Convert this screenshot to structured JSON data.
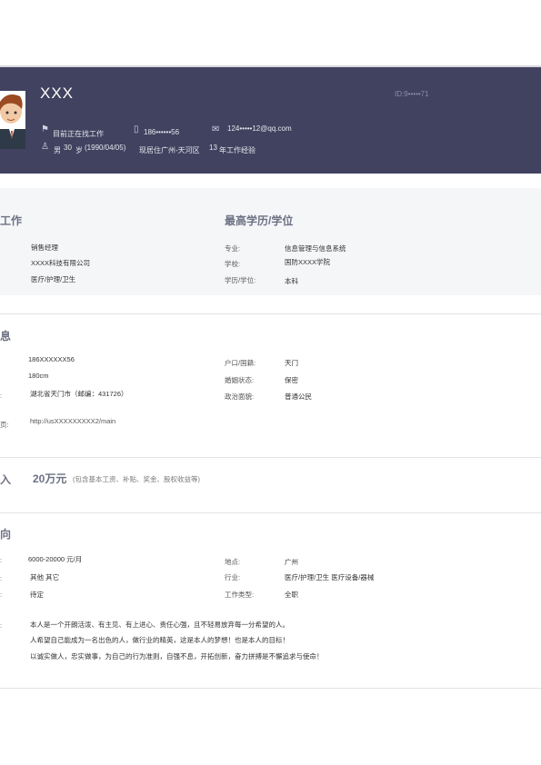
{
  "header": {
    "name": "XXX",
    "id": "ID:9•••••71",
    "status": "目前正在找工作",
    "phone": "186••••••56",
    "email": "124•••••12@qq.com",
    "gender": "男",
    "age": "30",
    "age_unit": "岁",
    "birth": "(1990/04/05)",
    "residence": "现居住广州-天河区",
    "experience_years": "13",
    "experience_label": "年工作经验"
  },
  "work": {
    "title": "工作",
    "position": "销售经理",
    "company": "XXXX科技有限公司",
    "industry": "医疗/护理/卫生"
  },
  "education": {
    "title": "最高学历/学位",
    "rows": [
      {
        "label": "专业:",
        "value": "信息管理与信息系统"
      },
      {
        "label": "学校:",
        "value": "国防XXXX学院"
      },
      {
        "label": "学历/学位:",
        "value": "本科"
      }
    ]
  },
  "personal": {
    "title": "息",
    "left": [
      {
        "label": "",
        "value": "186XXXXXX56"
      },
      {
        "label": "",
        "value": "180cm"
      },
      {
        "label": ":",
        "value": "湖北省天门市（邮编：431726）"
      },
      {
        "label": "页:",
        "value": "http://usXXXXXXXXX2/main"
      }
    ],
    "right": [
      {
        "label": "户口/国籍:",
        "value": "天门"
      },
      {
        "label": "婚姻状态:",
        "value": "保密"
      },
      {
        "label": "政治面貌:",
        "value": "普通公民"
      }
    ]
  },
  "income": {
    "title": "入",
    "amount": "20万元",
    "note": "(包含基本工资、补贴、奖金、股权收益等)"
  },
  "intention": {
    "title": "向",
    "left": [
      {
        "label": ":",
        "value": "6000-20000 元/月"
      },
      {
        "label": ":",
        "value": "其他 其它"
      },
      {
        "label": ":",
        "value": "待定"
      }
    ],
    "right": [
      {
        "label": "地点:",
        "value": "广州"
      },
      {
        "label": "行业:",
        "value": "医疗/护理/卫生 医疗设备/器械"
      },
      {
        "label": "工作类型:",
        "value": "全职"
      }
    ],
    "eval_label": ":",
    "eval_lines": [
      "本人是一个开朗活泼、有主见、有上进心、责任心强，且不轻易放弃每一分希望的人。",
      "人希望自己能成为一名出色的人，做行业的精英，这是本人的梦想！也是本人的目标！",
      "以诚实做人，忠实做事，为自己的行为准则，自强不息，开拓创新，奋力拼搏是不懈追求与使命！"
    ]
  }
}
